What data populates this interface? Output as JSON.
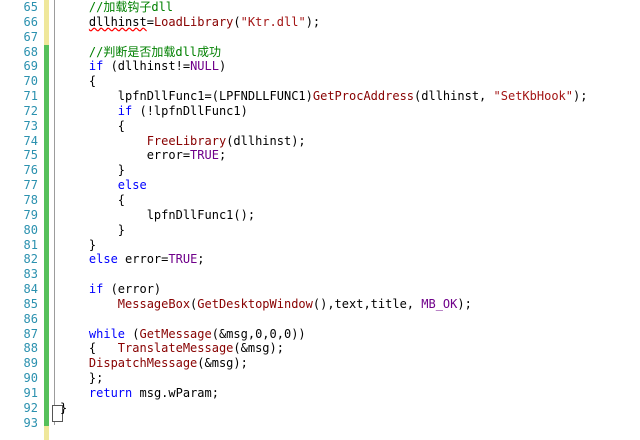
{
  "lines": [
    {
      "num": "65",
      "segs": [
        {
          "t": "    ",
          "c": ""
        },
        {
          "t": "//加载钩子dll",
          "c": "cm"
        }
      ]
    },
    {
      "num": "66",
      "segs": [
        {
          "t": "    dllhinst=",
          "c": ""
        },
        {
          "t": "LoadLibrary",
          "c": "fn"
        },
        {
          "t": "(",
          "c": ""
        },
        {
          "t": "\"Ktr.dll\"",
          "c": "st"
        },
        {
          "t": ");",
          "c": ""
        }
      ]
    },
    {
      "num": "67",
      "segs": []
    },
    {
      "num": "68",
      "segs": [
        {
          "t": "    ",
          "c": ""
        },
        {
          "t": "//判断是否加载dll成功",
          "c": "cm"
        }
      ]
    },
    {
      "num": "69",
      "segs": [
        {
          "t": "    ",
          "c": ""
        },
        {
          "t": "if",
          "c": "kw"
        },
        {
          "t": " (dllhinst!=",
          "c": ""
        },
        {
          "t": "NULL",
          "c": "mc"
        },
        {
          "t": ")",
          "c": ""
        }
      ]
    },
    {
      "num": "70",
      "segs": [
        {
          "t": "    {",
          "c": ""
        }
      ]
    },
    {
      "num": "71",
      "segs": [
        {
          "t": "        lpfnDllFunc1=(LPFNDLLFUNC1)",
          "c": ""
        },
        {
          "t": "GetProcAddress",
          "c": "fn"
        },
        {
          "t": "(dllhinst, ",
          "c": ""
        },
        {
          "t": "\"SetKbHook\"",
          "c": "st"
        },
        {
          "t": ");",
          "c": ""
        }
      ]
    },
    {
      "num": "72",
      "segs": [
        {
          "t": "        ",
          "c": ""
        },
        {
          "t": "if",
          "c": "kw"
        },
        {
          "t": " (!lpfnDllFunc1)",
          "c": ""
        }
      ]
    },
    {
      "num": "73",
      "segs": [
        {
          "t": "        {",
          "c": ""
        }
      ]
    },
    {
      "num": "74",
      "segs": [
        {
          "t": "            ",
          "c": ""
        },
        {
          "t": "FreeLibrary",
          "c": "fn"
        },
        {
          "t": "(dllhinst);",
          "c": ""
        }
      ]
    },
    {
      "num": "75",
      "segs": [
        {
          "t": "            error=",
          "c": ""
        },
        {
          "t": "TRUE",
          "c": "mc"
        },
        {
          "t": ";",
          "c": ""
        }
      ]
    },
    {
      "num": "76",
      "segs": [
        {
          "t": "        }",
          "c": ""
        }
      ]
    },
    {
      "num": "77",
      "segs": [
        {
          "t": "        ",
          "c": ""
        },
        {
          "t": "else",
          "c": "kw"
        }
      ]
    },
    {
      "num": "78",
      "segs": [
        {
          "t": "        {",
          "c": ""
        }
      ]
    },
    {
      "num": "79",
      "segs": [
        {
          "t": "            lpfnDllFunc1();",
          "c": ""
        }
      ]
    },
    {
      "num": "80",
      "segs": [
        {
          "t": "        }",
          "c": ""
        }
      ]
    },
    {
      "num": "81",
      "segs": [
        {
          "t": "    }",
          "c": ""
        }
      ]
    },
    {
      "num": "82",
      "segs": [
        {
          "t": "    ",
          "c": ""
        },
        {
          "t": "else",
          "c": "kw"
        },
        {
          "t": " error=",
          "c": ""
        },
        {
          "t": "TRUE",
          "c": "mc"
        },
        {
          "t": ";",
          "c": ""
        }
      ]
    },
    {
      "num": "83",
      "segs": []
    },
    {
      "num": "84",
      "segs": [
        {
          "t": "    ",
          "c": ""
        },
        {
          "t": "if",
          "c": "kw"
        },
        {
          "t": " (error)",
          "c": ""
        }
      ]
    },
    {
      "num": "85",
      "segs": [
        {
          "t": "        ",
          "c": ""
        },
        {
          "t": "MessageBox",
          "c": "fn"
        },
        {
          "t": "(",
          "c": ""
        },
        {
          "t": "GetDesktopWindow",
          "c": "fn"
        },
        {
          "t": "(),text,title, ",
          "c": ""
        },
        {
          "t": "MB_OK",
          "c": "mc"
        },
        {
          "t": ");",
          "c": ""
        }
      ]
    },
    {
      "num": "86",
      "segs": []
    },
    {
      "num": "87",
      "segs": [
        {
          "t": "    ",
          "c": ""
        },
        {
          "t": "while",
          "c": "kw"
        },
        {
          "t": " (",
          "c": ""
        },
        {
          "t": "GetMessage",
          "c": "fn"
        },
        {
          "t": "(&msg,0,0,0))",
          "c": ""
        }
      ]
    },
    {
      "num": "88",
      "segs": [
        {
          "t": "    {   ",
          "c": ""
        },
        {
          "t": "TranslateMessage",
          "c": "fn"
        },
        {
          "t": "(&msg);",
          "c": ""
        }
      ]
    },
    {
      "num": "89",
      "segs": [
        {
          "t": "    ",
          "c": ""
        },
        {
          "t": "DispatchMessage",
          "c": "fn"
        },
        {
          "t": "(&msg);",
          "c": ""
        }
      ]
    },
    {
      "num": "90",
      "segs": [
        {
          "t": "    };",
          "c": ""
        }
      ]
    },
    {
      "num": "91",
      "segs": [
        {
          "t": "    ",
          "c": ""
        },
        {
          "t": "return",
          "c": "kw"
        },
        {
          "t": " msg.wParam;",
          "c": ""
        }
      ]
    },
    {
      "num": "92",
      "segs": [
        {
          "t": "}",
          "c": ""
        }
      ]
    },
    {
      "num": "93",
      "segs": []
    }
  ],
  "colors": {
    "keyword": "#0000ff",
    "comment": "#008000",
    "function": "#880000",
    "string": "#a31515",
    "macro": "#6f008a",
    "line_number": "#2b91af",
    "changed_saved": "#56c05b",
    "changed_unsaved": "#efe79b"
  }
}
